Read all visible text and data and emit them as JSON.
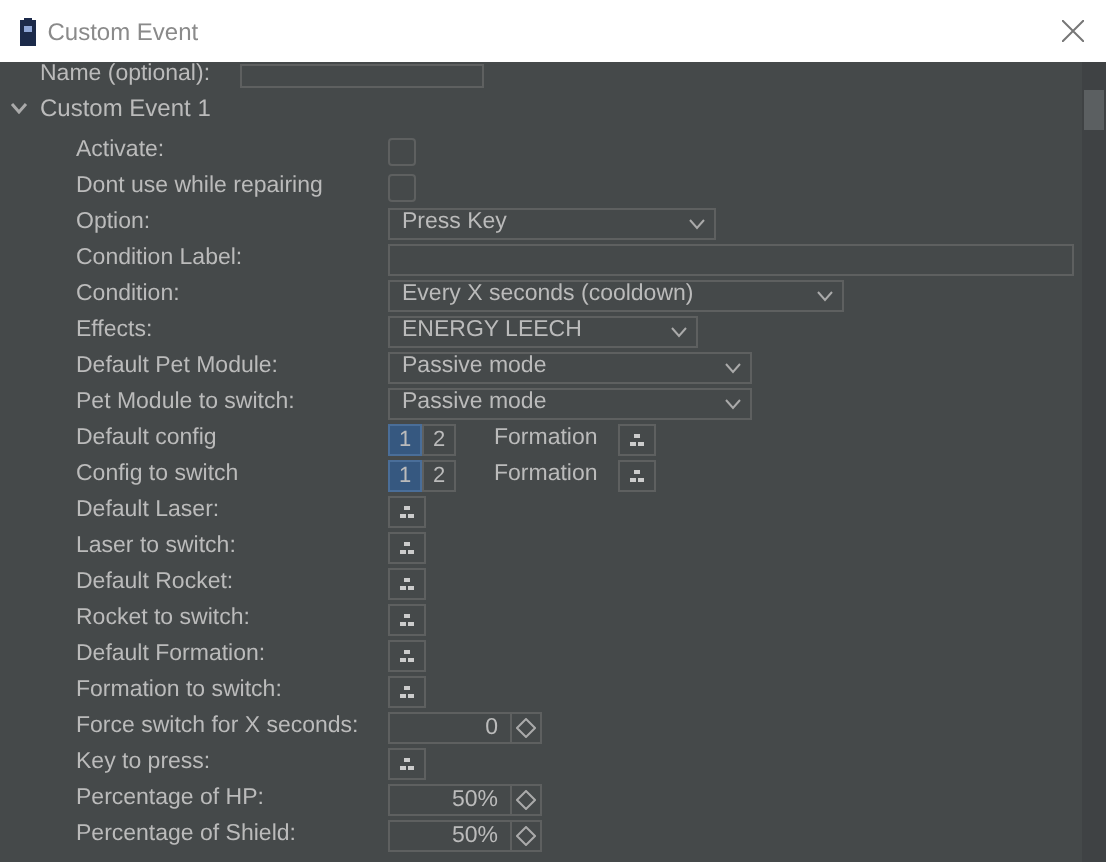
{
  "window": {
    "title": "Custom Event"
  },
  "name_field": {
    "label": "Name (optional):"
  },
  "section": {
    "title": "Custom Event 1",
    "expanded": true
  },
  "rows": [
    {
      "kind": "checkbox",
      "label": "Activate:",
      "checked": false
    },
    {
      "kind": "checkbox",
      "label": "Dont use while repairing",
      "checked": false
    },
    {
      "kind": "combo",
      "label": "Option:",
      "value": "Press Key"
    },
    {
      "kind": "text",
      "label": "Condition Label:"
    },
    {
      "kind": "combo",
      "label": "Condition:",
      "value": "Every X seconds (cooldown)"
    },
    {
      "kind": "combo",
      "label": "Effects:",
      "value": "ENERGY LEECH"
    },
    {
      "kind": "combo",
      "label": "Default Pet Module:",
      "value": "Passive mode"
    },
    {
      "kind": "combo",
      "label": "Pet Module to switch:",
      "value": "Passive mode"
    },
    {
      "kind": "config",
      "label": "Default config",
      "options": [
        {
          "label": "1",
          "selected": true
        },
        {
          "label": "2",
          "selected": false
        }
      ],
      "extra": "Formation"
    },
    {
      "kind": "config",
      "label": "Config to switch",
      "options": [
        {
          "label": "1",
          "selected": true
        },
        {
          "label": "2",
          "selected": false
        }
      ],
      "extra": "Formation"
    },
    {
      "kind": "pick",
      "label": "Default Laser:"
    },
    {
      "kind": "pick",
      "label": "Laser to switch:"
    },
    {
      "kind": "pick",
      "label": "Default Rocket:"
    },
    {
      "kind": "pick",
      "label": "Rocket to switch:"
    },
    {
      "kind": "pick",
      "label": "Default Formation:"
    },
    {
      "kind": "pick",
      "label": "Formation to switch:"
    },
    {
      "kind": "spinner",
      "label": "Force switch for X seconds:",
      "value": "0"
    },
    {
      "kind": "pick",
      "label": "Key to press:"
    },
    {
      "kind": "spinner",
      "label": "Percentage of HP:",
      "value": "50%"
    },
    {
      "kind": "spinner",
      "label": "Percentage of Shield:",
      "value": "50%"
    }
  ]
}
